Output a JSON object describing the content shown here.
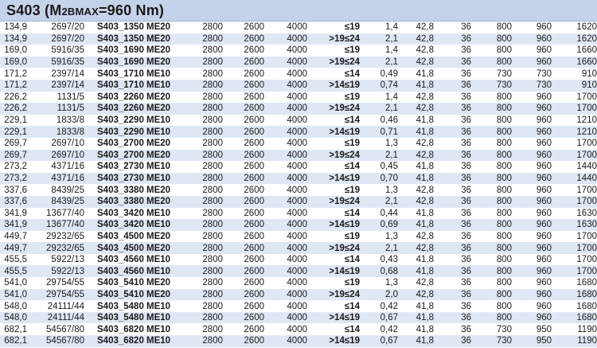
{
  "title": {
    "main": "S403 (M",
    "sub": "2BMAX",
    "rest": "=960 Nm)"
  },
  "rows": [
    [
      "134,9",
      "2697/20",
      "S403_1350 ME20",
      "2800",
      "2600",
      "4000",
      "≤19",
      "1,4",
      "42,8",
      "36",
      "800",
      "960",
      "1620"
    ],
    [
      "134,9",
      "2697/20",
      "S403_1350 ME20",
      "2800",
      "2600",
      "4000",
      ">19≤24",
      "2,1",
      "42,8",
      "36",
      "800",
      "960",
      "1620"
    ],
    [
      "169,0",
      "5916/35",
      "S403_1690 ME20",
      "2800",
      "2600",
      "4000",
      "≤19",
      "1,4",
      "42,8",
      "36",
      "800",
      "960",
      "1660"
    ],
    [
      "169,0",
      "5916/35",
      "S403_1690 ME20",
      "2800",
      "2600",
      "4000",
      ">19≤24",
      "2,1",
      "42,8",
      "36",
      "800",
      "960",
      "1660"
    ],
    [
      "171,2",
      "2397/14",
      "S403_1710 ME10",
      "2800",
      "2600",
      "4000",
      "≤14",
      "0,49",
      "41,8",
      "36",
      "730",
      "730",
      "910"
    ],
    [
      "171,2",
      "2397/14",
      "S403_1710 ME10",
      "2800",
      "2600",
      "4000",
      ">14≤19",
      "0,74",
      "41,8",
      "36",
      "730",
      "730",
      "910"
    ],
    [
      "226,2",
      "1131/5",
      "S403_2260 ME20",
      "2800",
      "2600",
      "4000",
      "≤19",
      "1,4",
      "42,8",
      "36",
      "800",
      "960",
      "1700"
    ],
    [
      "226,2",
      "1131/5",
      "S403_2260 ME20",
      "2800",
      "2600",
      "4000",
      ">19≤24",
      "2,1",
      "42,8",
      "36",
      "800",
      "960",
      "1700"
    ],
    [
      "229,1",
      "1833/8",
      "S403_2290 ME10",
      "2800",
      "2600",
      "4000",
      "≤14",
      "0,46",
      "41,8",
      "36",
      "800",
      "960",
      "1210"
    ],
    [
      "229,1",
      "1833/8",
      "S403_2290 ME10",
      "2800",
      "2600",
      "4000",
      ">14≤19",
      "0,71",
      "41,8",
      "36",
      "800",
      "960",
      "1210"
    ],
    [
      "269,7",
      "2697/10",
      "S403_2700 ME20",
      "2800",
      "2600",
      "4000",
      "≤19",
      "1,3",
      "42,8",
      "36",
      "800",
      "960",
      "1700"
    ],
    [
      "269,7",
      "2697/10",
      "S403_2700 ME20",
      "2800",
      "2600",
      "4000",
      ">19≤24",
      "2,1",
      "42,8",
      "36",
      "800",
      "960",
      "1700"
    ],
    [
      "273,2",
      "4371/16",
      "S403_2730 ME10",
      "2800",
      "2600",
      "4000",
      "≤14",
      "0,45",
      "41,8",
      "36",
      "800",
      "960",
      "1440"
    ],
    [
      "273,2",
      "4371/16",
      "S403_2730 ME10",
      "2800",
      "2600",
      "4000",
      ">14≤19",
      "0,70",
      "41,8",
      "36",
      "800",
      "960",
      "1440"
    ],
    [
      "337,6",
      "8439/25",
      "S403_3380 ME20",
      "2800",
      "2600",
      "4000",
      "≤19",
      "1,3",
      "42,8",
      "36",
      "800",
      "960",
      "1700"
    ],
    [
      "337,6",
      "8439/25",
      "S403_3380 ME20",
      "2800",
      "2600",
      "4000",
      ">19≤24",
      "2,1",
      "42,8",
      "36",
      "800",
      "960",
      "1700"
    ],
    [
      "341,9",
      "13677/40",
      "S403_3420 ME10",
      "2800",
      "2600",
      "4000",
      "≤14",
      "0,44",
      "41,8",
      "36",
      "800",
      "960",
      "1630"
    ],
    [
      "341,9",
      "13677/40",
      "S403_3420 ME10",
      "2800",
      "2600",
      "4000",
      ">14≤19",
      "0,69",
      "41,8",
      "36",
      "800",
      "960",
      "1630"
    ],
    [
      "449,7",
      "29232/65",
      "S403_4500 ME20",
      "2800",
      "2600",
      "4000",
      "≤19",
      "1,3",
      "42,8",
      "36",
      "800",
      "960",
      "1700"
    ],
    [
      "449,7",
      "29232/65",
      "S403_4500 ME20",
      "2800",
      "2600",
      "4000",
      ">19≤24",
      "2,1",
      "42,8",
      "36",
      "800",
      "960",
      "1700"
    ],
    [
      "455,5",
      "5922/13",
      "S403_4560 ME10",
      "2800",
      "2600",
      "4000",
      "≤14",
      "0,43",
      "41,8",
      "36",
      "800",
      "960",
      "1700"
    ],
    [
      "455,5",
      "5922/13",
      "S403_4560 ME10",
      "2800",
      "2600",
      "4000",
      ">14≤19",
      "0,68",
      "41,8",
      "36",
      "800",
      "960",
      "1700"
    ],
    [
      "541,0",
      "29754/55",
      "S403_5410 ME20",
      "2800",
      "2600",
      "4000",
      "≤19",
      "1,3",
      "42,8",
      "36",
      "800",
      "960",
      "1680"
    ],
    [
      "541,0",
      "29754/55",
      "S403_5410 ME20",
      "2800",
      "2600",
      "4000",
      ">19≤24",
      "2,0",
      "42,8",
      "36",
      "800",
      "960",
      "1680"
    ],
    [
      "548,0",
      "24111/44",
      "S403_5480 ME10",
      "2800",
      "2600",
      "4000",
      "≤14",
      "0,42",
      "41,8",
      "36",
      "800",
      "960",
      "1680"
    ],
    [
      "548,0",
      "24111/44",
      "S403_5480 ME10",
      "2800",
      "2600",
      "4000",
      ">14≤19",
      "0,67",
      "41,8",
      "36",
      "800",
      "960",
      "1680"
    ],
    [
      "682,1",
      "54567/80",
      "S403_6820 ME10",
      "2800",
      "2600",
      "4000",
      "≤14",
      "0,42",
      "41,8",
      "36",
      "730",
      "950",
      "1190"
    ],
    [
      "682,1",
      "54567/80",
      "S403_6820 ME10",
      "2800",
      "2600",
      "4000",
      ">14≤19",
      "0,67",
      "41,8",
      "36",
      "730",
      "950",
      "1190"
    ]
  ]
}
